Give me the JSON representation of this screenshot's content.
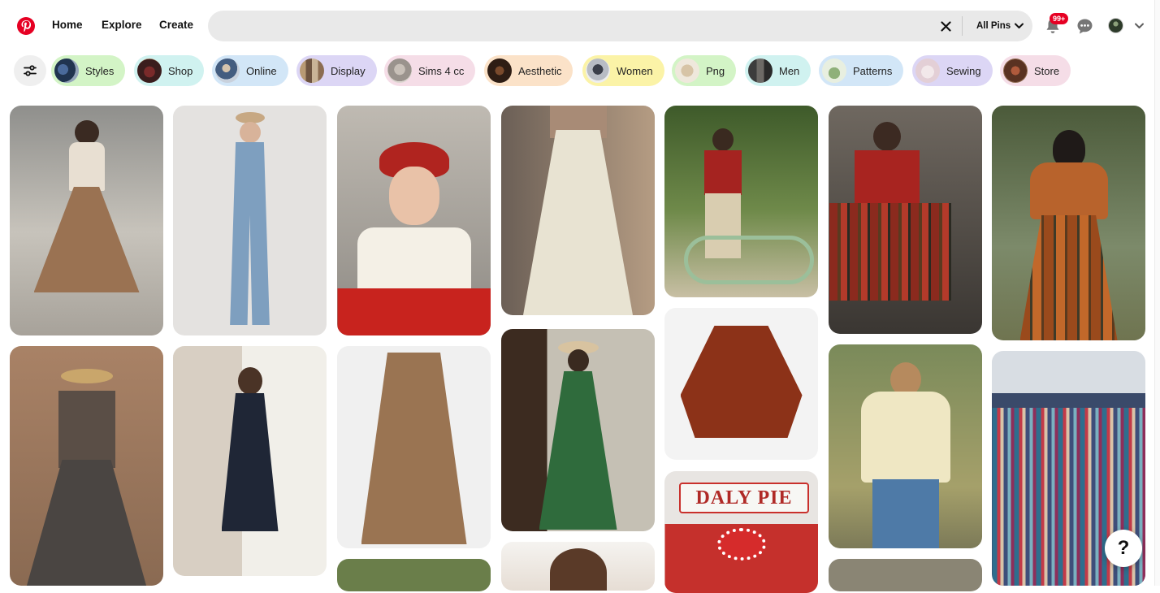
{
  "header": {
    "logo_icon": "pinterest-logo",
    "nav": [
      {
        "label": "Home"
      },
      {
        "label": "Explore"
      },
      {
        "label": "Create"
      }
    ],
    "search": {
      "value": "",
      "placeholder": ""
    },
    "scope": {
      "label": "All Pins"
    },
    "notifications": {
      "badge": "99+"
    },
    "accent": "#e60023"
  },
  "chips": [
    {
      "label": "Styles",
      "bg": "#d3f4c6"
    },
    {
      "label": "Shop",
      "bg": "#d0f2f0"
    },
    {
      "label": "Online",
      "bg": "#d2e6f7"
    },
    {
      "label": "Display",
      "bg": "#dcd6f5"
    },
    {
      "label": "Sims 4 cc",
      "bg": "#f5dde7"
    },
    {
      "label": "Aesthetic",
      "bg": "#fbe2c8"
    },
    {
      "label": "Women",
      "bg": "#fbf3a7"
    },
    {
      "label": "Png",
      "bg": "#d3f4c6"
    },
    {
      "label": "Men",
      "bg": "#d0f2f0"
    },
    {
      "label": "Patterns",
      "bg": "#d2e6f7"
    },
    {
      "label": "Sewing",
      "bg": "#dcd6f5"
    },
    {
      "label": "Store",
      "bg": "#f5dde7"
    }
  ],
  "help": {
    "label": "?"
  },
  "daly_sign": "DALY PIE"
}
